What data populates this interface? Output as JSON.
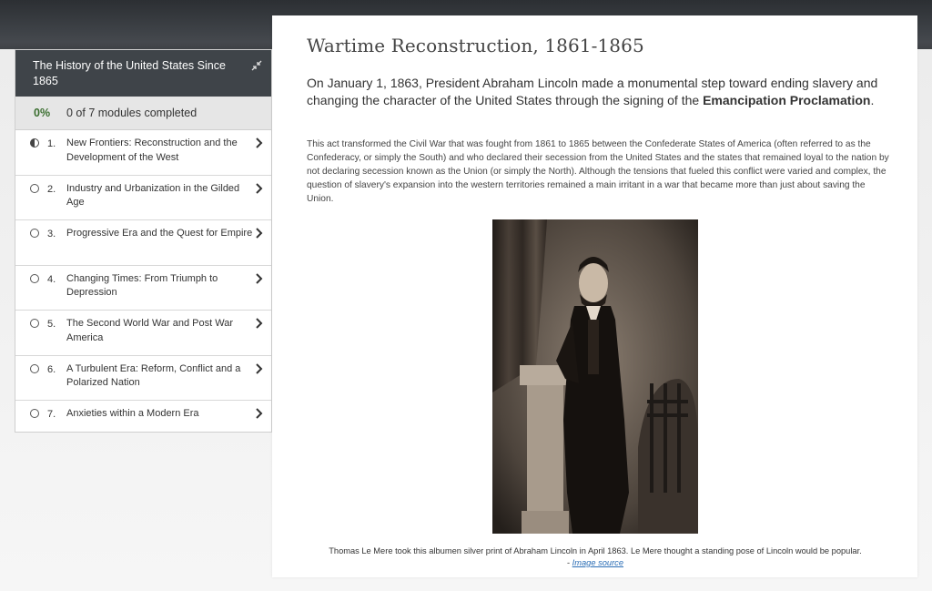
{
  "sidebar": {
    "course_title": "The History of the United States Since 1865",
    "progress_percent": "0%",
    "progress_text": "0 of 7 modules completed",
    "modules": [
      {
        "number": "1.",
        "title": "New Frontiers: Reconstruction and the Development of the West",
        "status": "in-progress"
      },
      {
        "number": "2.",
        "title": "Industry and Urbanization in the Gilded Age",
        "status": "not-started"
      },
      {
        "number": "3.",
        "title": "Progressive Era and the Quest for Empire",
        "status": "not-started"
      },
      {
        "number": "4.",
        "title": "Changing Times: From Triumph to Depression",
        "status": "not-started"
      },
      {
        "number": "5.",
        "title": "The Second World War and Post War America",
        "status": "not-started"
      },
      {
        "number": "6.",
        "title": "A Turbulent Era: Reform, Conflict and a Polarized Nation",
        "status": "not-started"
      },
      {
        "number": "7.",
        "title": "Anxieties within a Modern Era",
        "status": "not-started"
      }
    ]
  },
  "content": {
    "title": "Wartime Reconstruction, 1861-1865",
    "lead_text": "On January 1, 1863, President Abraham Lincoln made a monumental step toward ending slavery and changing the character of the United States through the signing of the ",
    "lead_bold": "Emancipation Proclamation",
    "lead_end": ".",
    "body": "This act transformed the Civil War that was fought from 1861 to 1865 between the Confederate States of America (often referred to as the Confederacy, or simply the South) and who declared their secession from the United States and the states that remained loyal to the nation by not declaring secession known as the Union (or simply the North). Although the tensions that fueled this conflict were varied and complex, the question of slavery's expansion into the western territories remained a main irritant in a war that became more than just about saving the Union.",
    "caption": "Thomas Le Mere took this albumen silver print of Abraham Lincoln in April 1863. Le Mere thought a standing pose of Lincoln would be popular.",
    "source_prefix": "- ",
    "source_link": "Image source"
  },
  "colors": {
    "sidebar_header_bg": "#3f4449",
    "progress_green": "#3a6e2f",
    "link_blue": "#2a6db5"
  }
}
